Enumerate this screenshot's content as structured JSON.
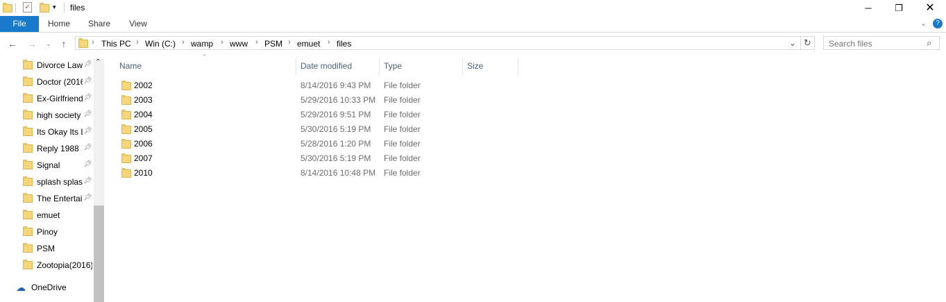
{
  "window": {
    "title": "files"
  },
  "ribbon": {
    "tabs": [
      "File",
      "Home",
      "Share",
      "View"
    ]
  },
  "address": {
    "crumbs": [
      "This PC",
      "Win (C:)",
      "wamp",
      "www",
      "PSM",
      "emuet",
      "files"
    ]
  },
  "search": {
    "placeholder": "Search files"
  },
  "sidebar": {
    "items": [
      {
        "label": "Divorce Law",
        "pinned": true
      },
      {
        "label": "Doctor (2016",
        "pinned": true
      },
      {
        "label": "Ex-Girlfriend",
        "pinned": true
      },
      {
        "label": "high society",
        "pinned": true
      },
      {
        "label": "Its Okay Its L",
        "pinned": true
      },
      {
        "label": "Reply 1988",
        "pinned": true
      },
      {
        "label": "Signal",
        "pinned": true
      },
      {
        "label": "splash splash",
        "pinned": true
      },
      {
        "label": "The Entertai",
        "pinned": true
      },
      {
        "label": "emuet",
        "pinned": false
      },
      {
        "label": "Pinoy",
        "pinned": false
      },
      {
        "label": "PSM",
        "pinned": false
      },
      {
        "label": "Zootopia(2016)",
        "pinned": false
      }
    ],
    "onedrive": "OneDrive"
  },
  "columns": {
    "name": "Name",
    "date": "Date modified",
    "type": "Type",
    "size": "Size"
  },
  "files": [
    {
      "name": "2002",
      "date": "8/14/2016 9:43 PM",
      "type": "File folder"
    },
    {
      "name": "2003",
      "date": "5/29/2016 10:33 PM",
      "type": "File folder"
    },
    {
      "name": "2004",
      "date": "5/29/2016 9:51 PM",
      "type": "File folder"
    },
    {
      "name": "2005",
      "date": "5/30/2016 5:19 PM",
      "type": "File folder"
    },
    {
      "name": "2006",
      "date": "5/28/2016 1:20 PM",
      "type": "File folder"
    },
    {
      "name": "2007",
      "date": "5/30/2016 5:19 PM",
      "type": "File folder"
    },
    {
      "name": "2010",
      "date": "8/14/2016 10:48 PM",
      "type": "File folder"
    }
  ]
}
